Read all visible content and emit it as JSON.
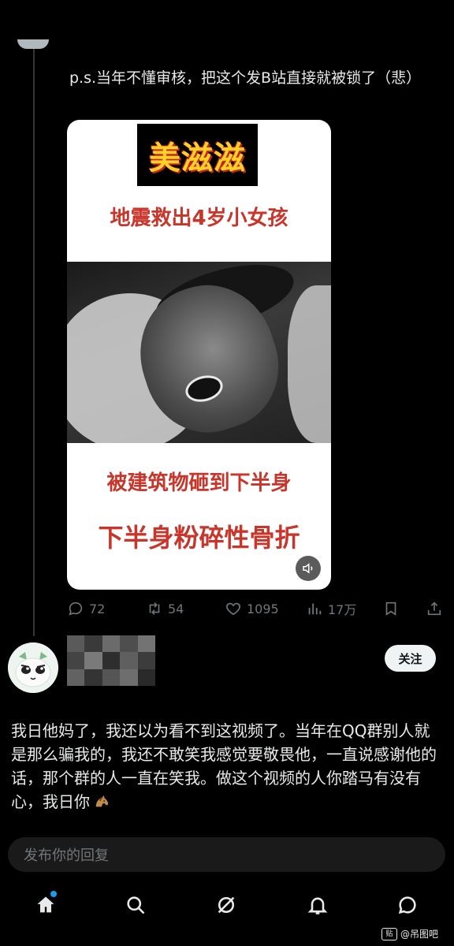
{
  "post": {
    "caption": "p.s.当年不懂审核，把这个发B站直接就被锁了（悲）",
    "media": {
      "brand": "美滋滋",
      "headline_1": "地震救出4岁小女孩",
      "headline_2": "被建筑物砸到下半身",
      "headline_3": "下半身粉碎性骨折"
    },
    "stats": {
      "replies": "72",
      "reposts": "54",
      "likes": "1095",
      "views": "17万"
    }
  },
  "reply": {
    "follow_label": "关注",
    "text": "我日他妈了，我还以为看不到这视频了。当年在QQ群别人就是那么骗我的，我还不敢笑我感觉要敬畏他，一直说感谢他的话，那个群的人一直在笑我。做这个视频的人你踏马有没有心，我日你"
  },
  "composer": {
    "placeholder": "发布你的回复"
  },
  "tabs": [
    "home",
    "search",
    "grok",
    "notifications",
    "messages"
  ],
  "watermark": "@吊图吧",
  "colors": {
    "background": "#000000",
    "headline_red": "#c7352b",
    "accent_blue": "#1d9bf0",
    "muted": "#71767b"
  }
}
